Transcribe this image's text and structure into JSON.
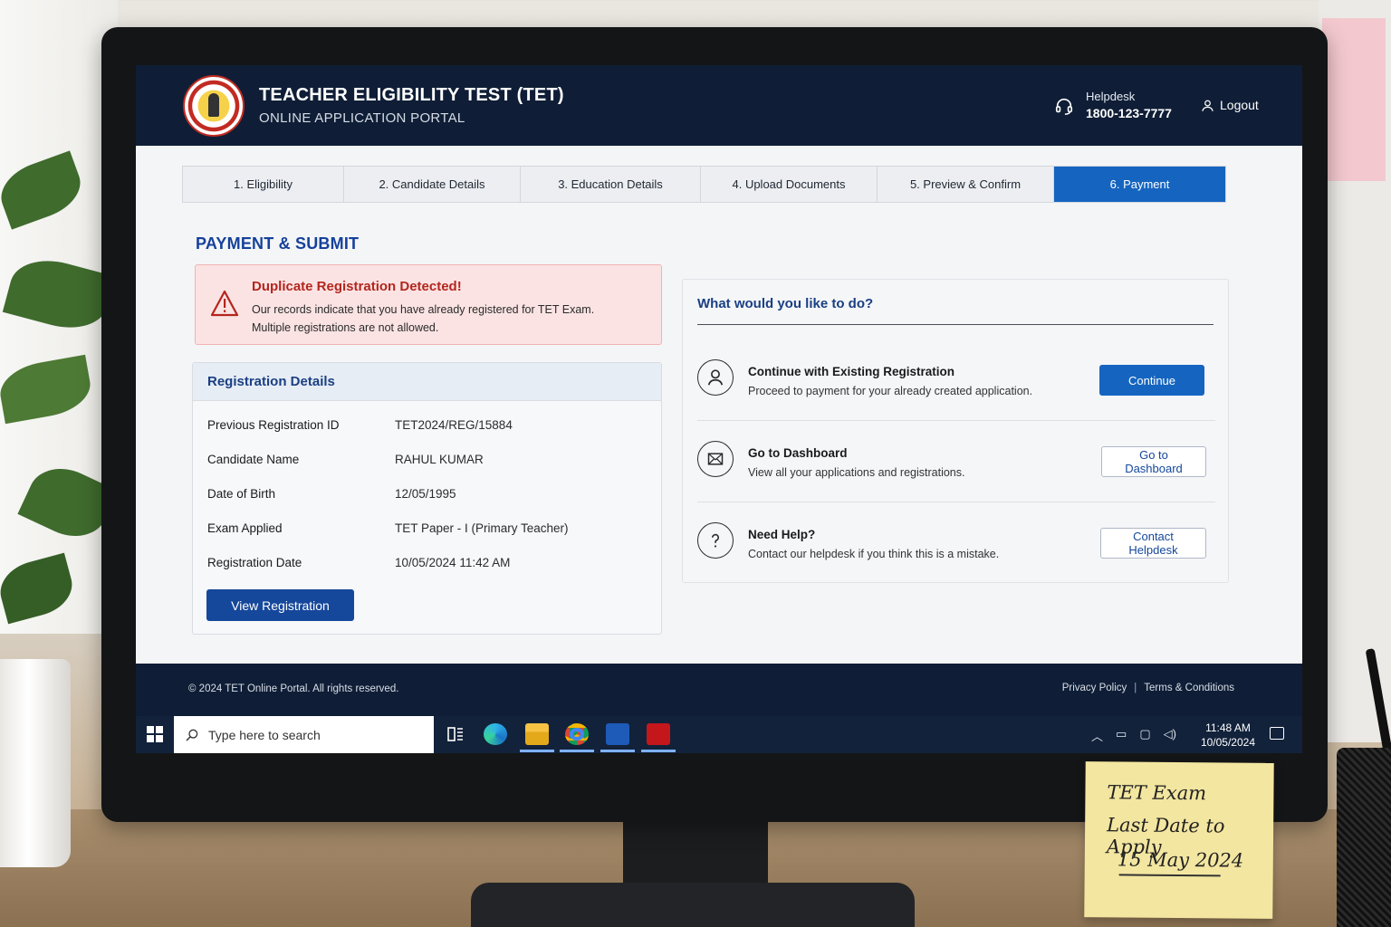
{
  "header": {
    "title": "TEACHER ELIGIBILITY TEST (TET)",
    "subtitle": "ONLINE APPLICATION PORTAL",
    "helpdesk_label": "Helpdesk",
    "helpdesk_phone": "1800-123-7777",
    "logout_label": "Logout"
  },
  "steps": [
    {
      "label": "1.  Eligibility",
      "active": false
    },
    {
      "label": "2.  Candidate Details",
      "active": false
    },
    {
      "label": "3.  Education Details",
      "active": false
    },
    {
      "label": "4.  Upload Documents",
      "active": false
    },
    {
      "label": "5.  Preview & Confirm",
      "active": false
    },
    {
      "label": "6.  Payment",
      "active": true
    }
  ],
  "page_title": "PAYMENT & SUBMIT",
  "alert": {
    "title": "Duplicate Registration Detected!",
    "line1": "Our records indicate that you have already registered for TET Exam.",
    "line2": "Multiple registrations are not allowed."
  },
  "registration": {
    "heading": "Registration Details",
    "rows": [
      {
        "label": "Previous Registration ID",
        "value": "TET2024/REG/15884"
      },
      {
        "label": "Candidate Name",
        "value": "RAHUL KUMAR"
      },
      {
        "label": "Date of Birth",
        "value": "12/05/1995"
      },
      {
        "label": "Exam Applied",
        "value": "TET Paper - I (Primary Teacher)"
      },
      {
        "label": "Registration Date",
        "value": "10/05/2024 11:42 AM"
      }
    ],
    "view_button": "View Registration"
  },
  "options": {
    "heading": "What would you like to do?",
    "items": [
      {
        "icon": "user-icon",
        "title": "Continue with Existing Registration",
        "desc": "Proceed to payment for your already created application.",
        "button": "Continue"
      },
      {
        "icon": "mail-icon",
        "title": "Go to Dashboard",
        "desc": "View all your applications and registrations.",
        "button": "Go to Dashboard"
      },
      {
        "icon": "question-icon",
        "title": "Need Help?",
        "desc": "Contact our helpdesk if you think this is a mistake.",
        "button": "Contact Helpdesk"
      }
    ]
  },
  "footer": {
    "copyright": "© 2024 TET Online Portal. All rights reserved.",
    "privacy": "Privacy Policy",
    "separator": "|",
    "terms": "Terms & Conditions"
  },
  "taskbar": {
    "search_placeholder": "Type here to search",
    "time": "11:48 AM",
    "date": "10/05/2024"
  },
  "sticky_note": {
    "line1": "TET Exam",
    "line2": "Last Date to Apply",
    "line3": "15 May 2024"
  },
  "colors": {
    "header_bg": "#0f1e36",
    "accent": "#1565c0",
    "alert_bg": "#fbe3e3",
    "alert_text": "#b3261e"
  }
}
